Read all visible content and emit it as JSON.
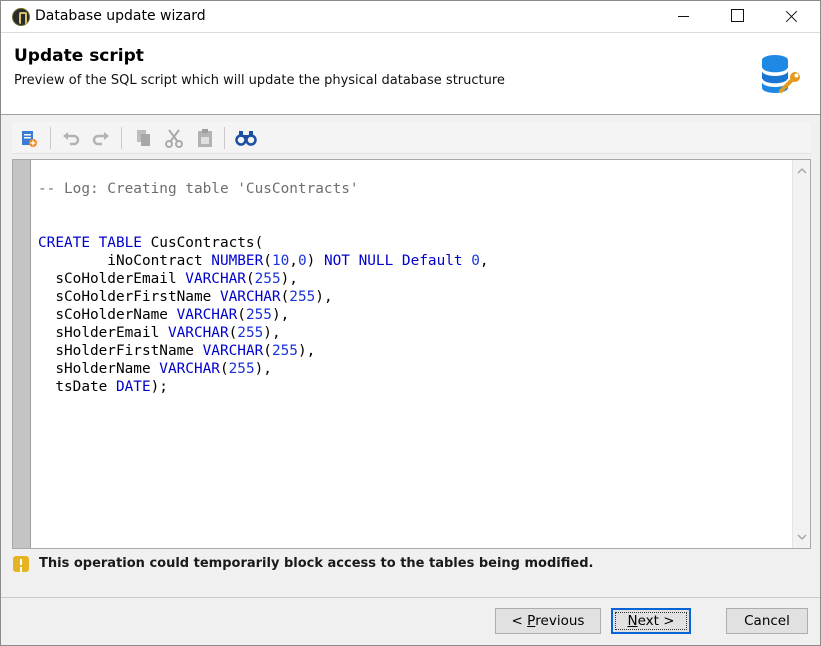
{
  "window": {
    "title": "Database update wizard"
  },
  "header": {
    "title": "Update script",
    "subtitle": "Preview of the SQL script which will update the physical database structure",
    "icon": "database-settings-icon"
  },
  "toolbar": {
    "buttons": [
      {
        "name": "new-file-icon",
        "enabled": true
      },
      {
        "name": "undo-icon",
        "enabled": false
      },
      {
        "name": "redo-icon",
        "enabled": false
      },
      {
        "name": "copy-icon",
        "enabled": false
      },
      {
        "name": "cut-icon",
        "enabled": false
      },
      {
        "name": "paste-icon",
        "enabled": false
      },
      {
        "name": "find-icon",
        "enabled": true
      }
    ]
  },
  "editor": {
    "lines": [
      [
        {
          "t": "-- Log: Creating table 'CusContracts'",
          "k": "comment"
        }
      ],
      [],
      [],
      [
        {
          "t": "CREATE TABLE",
          "k": "kw"
        },
        {
          "t": " CusContracts(",
          "k": "plain"
        }
      ],
      [
        {
          "t": "        iNoContract ",
          "k": "plain"
        },
        {
          "t": "NUMBER",
          "k": "kw"
        },
        {
          "t": "(",
          "k": "plain"
        },
        {
          "t": "10",
          "k": "num"
        },
        {
          "t": ",",
          "k": "plain"
        },
        {
          "t": "0",
          "k": "num"
        },
        {
          "t": ") ",
          "k": "plain"
        },
        {
          "t": "NOT NULL Default",
          "k": "kw"
        },
        {
          "t": " ",
          "k": "plain"
        },
        {
          "t": "0",
          "k": "num"
        },
        {
          "t": ",",
          "k": "plain"
        }
      ],
      [
        {
          "t": "  sCoHolderEmail ",
          "k": "plain"
        },
        {
          "t": "VARCHAR",
          "k": "kw"
        },
        {
          "t": "(",
          "k": "plain"
        },
        {
          "t": "255",
          "k": "num"
        },
        {
          "t": "),",
          "k": "plain"
        }
      ],
      [
        {
          "t": "  sCoHolderFirstName ",
          "k": "plain"
        },
        {
          "t": "VARCHAR",
          "k": "kw"
        },
        {
          "t": "(",
          "k": "plain"
        },
        {
          "t": "255",
          "k": "num"
        },
        {
          "t": "),",
          "k": "plain"
        }
      ],
      [
        {
          "t": "  sCoHolderName ",
          "k": "plain"
        },
        {
          "t": "VARCHAR",
          "k": "kw"
        },
        {
          "t": "(",
          "k": "plain"
        },
        {
          "t": "255",
          "k": "num"
        },
        {
          "t": "),",
          "k": "plain"
        }
      ],
      [
        {
          "t": "  sHolderEmail ",
          "k": "plain"
        },
        {
          "t": "VARCHAR",
          "k": "kw"
        },
        {
          "t": "(",
          "k": "plain"
        },
        {
          "t": "255",
          "k": "num"
        },
        {
          "t": "),",
          "k": "plain"
        }
      ],
      [
        {
          "t": "  sHolderFirstName ",
          "k": "plain"
        },
        {
          "t": "VARCHAR",
          "k": "kw"
        },
        {
          "t": "(",
          "k": "plain"
        },
        {
          "t": "255",
          "k": "num"
        },
        {
          "t": "),",
          "k": "plain"
        }
      ],
      [
        {
          "t": "  sHolderName ",
          "k": "plain"
        },
        {
          "t": "VARCHAR",
          "k": "kw"
        },
        {
          "t": "(",
          "k": "plain"
        },
        {
          "t": "255",
          "k": "num"
        },
        {
          "t": "),",
          "k": "plain"
        }
      ],
      [
        {
          "t": "  tsDate ",
          "k": "plain"
        },
        {
          "t": "DATE",
          "k": "kw"
        },
        {
          "t": ");",
          "k": "plain"
        }
      ]
    ]
  },
  "warning": {
    "icon": "warning-icon",
    "text": "This operation could temporarily block access to the tables being modified."
  },
  "footer": {
    "previous_prefix": "< ",
    "previous_mnemonic": "P",
    "previous_rest": "revious",
    "next_mnemonic": "N",
    "next_rest": "ext >",
    "cancel_label": "Cancel"
  },
  "colors": {
    "keyword": "#0000cc",
    "number": "#1a33d8",
    "comment": "#6e6e6e",
    "warning": "#e6b422",
    "focus": "#0a64d6"
  }
}
